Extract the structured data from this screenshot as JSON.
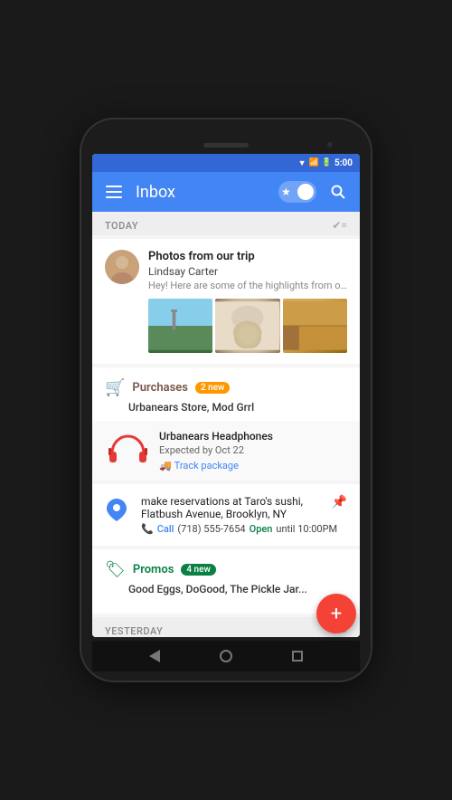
{
  "statusBar": {
    "time": "5:00"
  },
  "appBar": {
    "menuLabel": "☰",
    "title": "Inbox",
    "searchLabel": "🔍",
    "starLabel": "★"
  },
  "sections": {
    "today": "Today",
    "yesterday": "Yesterday"
  },
  "emailCard": {
    "subject": "Photos from our trip",
    "sender": "Lindsay Carter",
    "preview": "Hey! Here are some of the highlights from our trip t..."
  },
  "purchasesCard": {
    "icon": "🛒",
    "title": "Purchases",
    "badgeCount": "2 new",
    "subtitle": "Urbanears Store, Mod Grrl",
    "package": {
      "name": "Urbanears Headphones",
      "expectedDate": "Expected by Oct 22",
      "trackLabel": "Track package"
    }
  },
  "reservationCard": {
    "title": "make reservations at Taro's sushi, Flatbush Avenue, Brooklyn, NY",
    "callLabel": "Call",
    "phone": "(718) 555-7654",
    "openText": "Open",
    "hours": "until 10:00PM"
  },
  "promosCard": {
    "icon": "🏷",
    "title": "Promos",
    "badgeCount": "4 new",
    "subtitle": "Good Eggs, DoGood, The Pickle Jar..."
  },
  "fab": {
    "label": "+"
  },
  "nav": {
    "back": "◁",
    "home": "○",
    "recent": "□"
  }
}
